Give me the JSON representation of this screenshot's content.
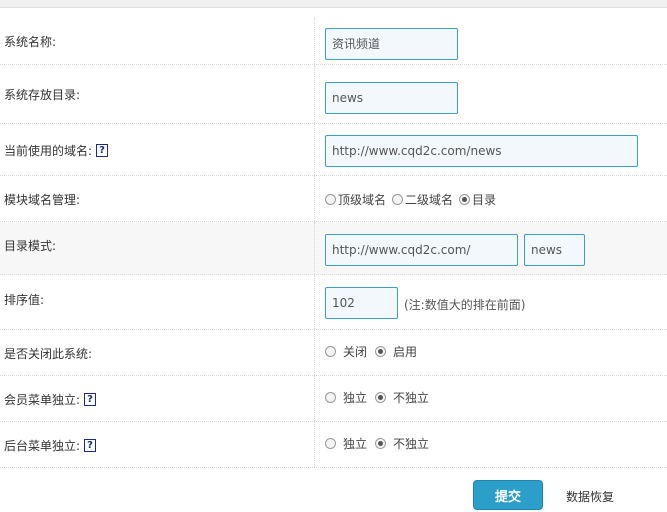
{
  "form": {
    "system_name": {
      "label": "系统名称:",
      "value": "资讯频道"
    },
    "dir": {
      "label": "系统存放目录:",
      "value": "news"
    },
    "domain": {
      "label": "当前使用的域名:",
      "help": "?",
      "value": "http://www.cqd2c.com/news"
    },
    "domain_mgmt": {
      "label": "模块域名管理:",
      "options": [
        "顶级域名",
        "二级域名",
        "目录"
      ],
      "selected": "目录"
    },
    "dir_mode": {
      "label": "目录模式:",
      "base": "http://www.cqd2c.com/",
      "dir": "news"
    },
    "sort": {
      "label": "排序值:",
      "value": "102",
      "note": "(注:数值大的排在前面)"
    },
    "close_system": {
      "label": "是否关闭此系统:",
      "options": [
        "关闭",
        "启用"
      ],
      "selected": "启用"
    },
    "member_menu": {
      "label": "会员菜单独立:",
      "help": "?",
      "options": [
        "独立",
        "不独立"
      ],
      "selected": "不独立"
    },
    "admin_menu": {
      "label": "后台菜单独立:",
      "help": "?",
      "options": [
        "独立",
        "不独立"
      ],
      "selected": "不独立"
    }
  },
  "footer": {
    "submit_label": "提交",
    "restore_label": "数据恢复"
  },
  "colors": {
    "accent": "#2b9ec9",
    "input_border": "#3b9fc8"
  }
}
